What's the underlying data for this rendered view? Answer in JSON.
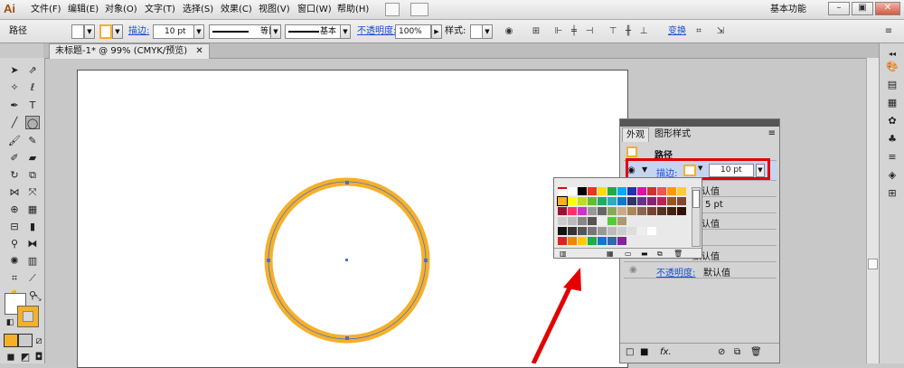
{
  "app": {
    "logo": "Ai"
  },
  "menu": [
    "文件(F)",
    "编辑(E)",
    "对象(O)",
    "文字(T)",
    "选择(S)",
    "效果(C)",
    "视图(V)",
    "窗口(W)",
    "帮助(H)"
  ],
  "workspace": "基本功能",
  "window_buttons": [
    "–",
    "▣",
    "✕"
  ],
  "control": {
    "object_label": "路径",
    "stroke_label": "描边:",
    "stroke_weight": "10 pt",
    "profile_label": "等比",
    "brush_label": "基本",
    "opacity_label": "不透明度:",
    "opacity_value": "100%",
    "style_label": "样式:",
    "transform_label": "变换"
  },
  "document_tab": "未标题-1* @ 99% (CMYK/预览)",
  "appearance_panel": {
    "tabs": [
      "外观",
      "图形样式"
    ],
    "header": "路径",
    "stroke_label": "描边:",
    "stroke_weight": "10 pt",
    "rows": [
      "默认值",
      "5 pt",
      "默认值",
      "默认值"
    ],
    "opacity_label": "不透明度:",
    "opacity_value": "默认值",
    "footer_fx": "fx."
  },
  "colors": {
    "stroke": "#f5b028",
    "accent_red": "#e30000",
    "link": "#1a4fd1"
  }
}
